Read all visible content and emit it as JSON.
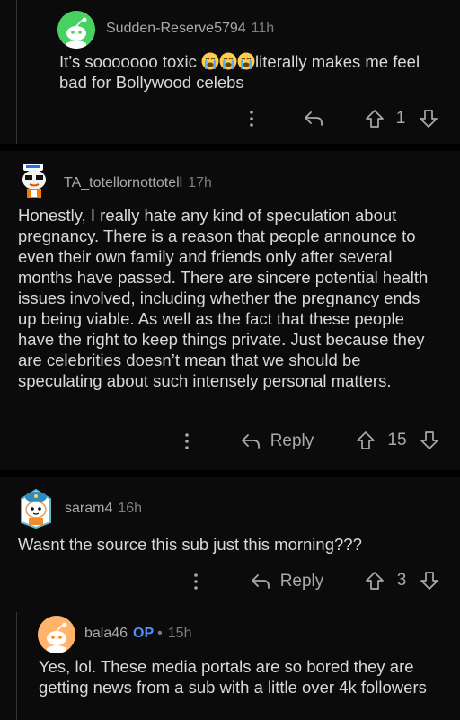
{
  "comments": [
    {
      "username": "Sudden-Reserve5794",
      "time": "11h",
      "text_before": "It’s sooooooo toxic ",
      "text_after": "literally makes me feel bad for Bollywood celebs",
      "emojis": [
        "loudly-crying-face",
        "loudly-crying-face",
        "loudly-crying-face"
      ],
      "score": "1",
      "avatar_color": "#46d160"
    },
    {
      "username": "TA_totellornottotell",
      "time": "17h",
      "text": "Honestly, I really hate any kind of speculation about pregnancy. There is a reason that people announce to even their own family and friends only after several months have passed. There are sincere potential health issues involved, including whether the pregnancy ends up being viable. As well as the fact that these people have the right to keep things private. Just because they are celebrities doesn’t mean that we should be speculating about such intensely personal matters.",
      "reply_label": "Reply",
      "score": "15"
    },
    {
      "username": "saram4",
      "time": "16h",
      "text": "Wasnt the source this sub just this morning???",
      "reply_label": "Reply",
      "score": "3"
    },
    {
      "username": "bala46",
      "op_badge": "OP",
      "separator": "•",
      "time": "15h",
      "text": "Yes, lol. These media portals are so bored they are getting news from a sub with a little over 4k followers",
      "avatar_color": "#ffb36b"
    }
  ],
  "colors": {
    "background": "#0b0b0b",
    "separator": "#000000",
    "op": "#4f8ff7",
    "text": "#d7dadc",
    "muted": "#8e9092"
  },
  "icons": [
    "more-vertical-icon",
    "reply-arrow-icon",
    "upvote-arrow-icon",
    "downvote-arrow-icon"
  ]
}
